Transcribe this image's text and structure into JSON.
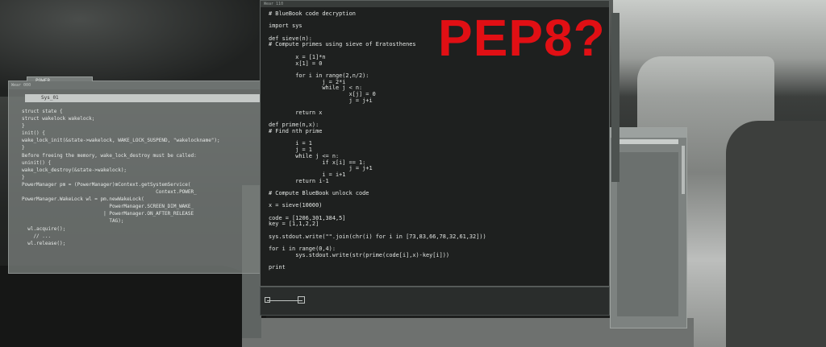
{
  "power_window": {
    "tab_label": "POWER",
    "title": "Wear 000",
    "sys_label": "Sys_01",
    "code_lines": [
      "struct state {",
      "struct wakelock wakelock;",
      "}",
      "init() {",
      "wake_lock_init(&state->wakelock, WAKE_LOCK_SUSPEND, \"wakelockname\");",
      "}",
      "Before freeing the memory, wake_lock_destroy must be called:",
      "uninit() {",
      "wake_lock_destroy(&state->wakelock);",
      "}",
      "PowerManager pm = (PowerManager)mContext.getSystemService(",
      "                                              Context.POWER_",
      "PowerManager.WakeLock wl = pm.newWakeLock(",
      "                              PowerManager.SCREEN_DIM_WAKE_",
      "                            | PowerManager.ON_AFTER_RELEASE",
      "                              TAG);",
      "  wl.acquire();",
      "    // ...",
      "  wl.release();"
    ]
  },
  "main_window": {
    "title": "Wear 110",
    "overlay_text": "PEP8?",
    "code_lines": [
      "# BlueBook code decryption",
      "",
      "import sys",
      "",
      "def sieve(n):",
      "# Compute primes using sieve of Eratosthenes",
      "",
      "        x = [1]*n",
      "        x[1] = 0",
      "",
      "        for i in range(2,n/2):",
      "                j = 2*i",
      "                while j < n:",
      "                        x[j] = 0",
      "                        j = j+i",
      "",
      "        return x",
      "",
      "def prime(n,x):",
      "# Find nth prime",
      "",
      "        i = 1",
      "        j = 1",
      "        while j <= n:",
      "                if x[i] == 1:",
      "                        j = j+1",
      "                i = i+1",
      "        return i-1",
      "",
      "# Compute BlueBook unlock code",
      "",
      "x = sieve(10000)",
      "",
      "code = [1206,301,384,5]",
      "key = [1,1,2,2]",
      "",
      "sys.stdout.write(\"\".join(chr(i) for i in [73,83,66,78,32,61,32]))",
      "",
      "for i in range(0,4):",
      "        sys.stdout.write(str(prime(code[i],x)-key[i]))",
      "",
      "print"
    ]
  },
  "colors": {
    "overlay_red": "#e10f14",
    "code_text": "#e3e6e4",
    "code_bg": "#1e201f"
  }
}
